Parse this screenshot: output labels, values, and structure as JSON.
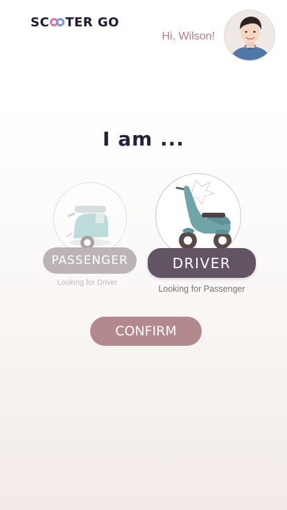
{
  "header": {
    "logo_prefix": "SC",
    "logo_suffix": "TER GO",
    "greeting": "Hi, Wilson!",
    "avatar_icon": "user-avatar"
  },
  "main": {
    "title": "I am ...",
    "roles": [
      {
        "label": "PASSENGER",
        "subtitle": "Looking for Driver",
        "icon": "scooter-icon",
        "selected": false
      },
      {
        "label": "DRIVER",
        "subtitle": "Looking for Passenger",
        "icon": "scooter-icon",
        "selected": true
      }
    ],
    "confirm_label": "CONFIRM"
  },
  "colors": {
    "brand_dark": "#1f1a33",
    "logo_pink": "#e6709b",
    "logo_blue": "#7a96d8",
    "greeting": "#b07d84",
    "driver_selected": "#625462",
    "passenger_unselected": "#bbb3b6",
    "confirm": "#b3898d",
    "scooter": "#6fa4a8"
  }
}
